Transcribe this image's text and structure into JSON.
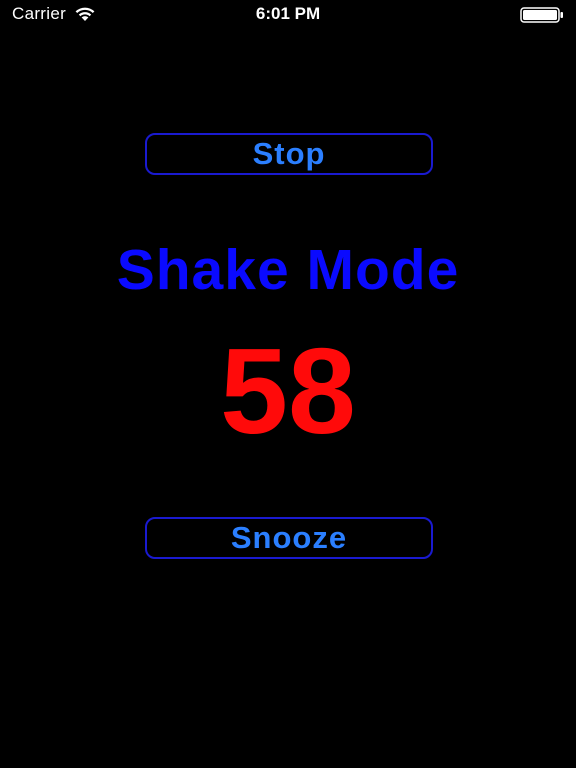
{
  "status_bar": {
    "carrier": "Carrier",
    "wifi_icon": "wifi-icon",
    "time": "6:01 PM",
    "battery_icon": "battery-full-icon"
  },
  "alarm": {
    "stop_label": "Stop",
    "mode_title": "Shake Mode",
    "countdown": "58",
    "snooze_label": "Snooze"
  },
  "colors": {
    "background": "#000000",
    "button_text": "#2b7fff",
    "button_border": "#1a1ad0",
    "mode_title": "#0a0aff",
    "countdown": "#ff0a0a"
  }
}
